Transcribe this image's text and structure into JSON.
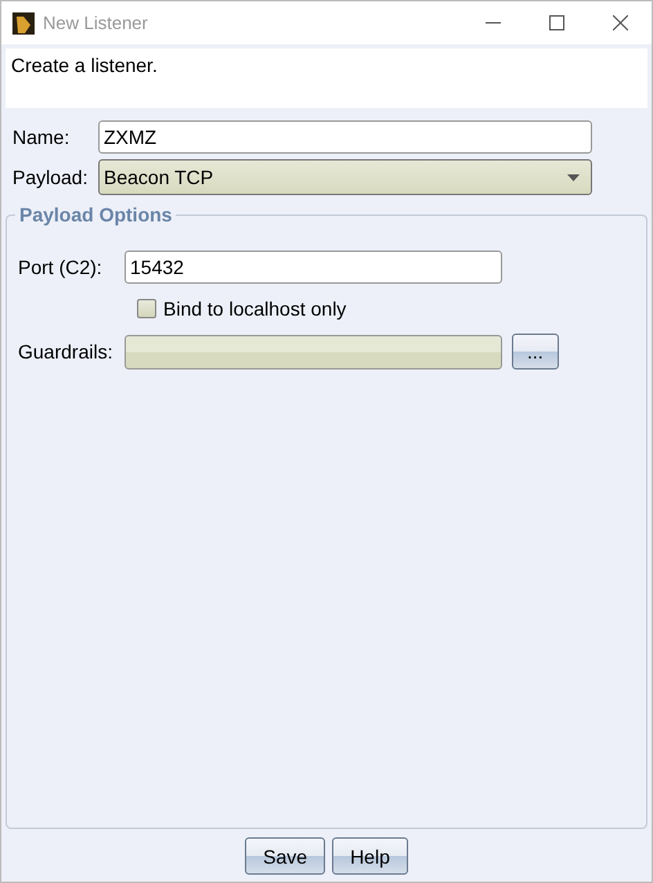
{
  "window": {
    "title": "New Listener"
  },
  "description": "Create a listener.",
  "name_field": {
    "label": "Name:",
    "value": "ZXMZ"
  },
  "payload_field": {
    "label": "Payload:",
    "value": "Beacon TCP"
  },
  "payload_options": {
    "title": "Payload Options",
    "port": {
      "label": "Port (C2):",
      "value": "15432"
    },
    "bind_localhost": {
      "label": "Bind to localhost only",
      "checked": false
    },
    "guardrails": {
      "label": "Guardrails:",
      "disabled": true,
      "button": "..."
    }
  },
  "buttons": [
    "Save",
    "Help"
  ]
}
